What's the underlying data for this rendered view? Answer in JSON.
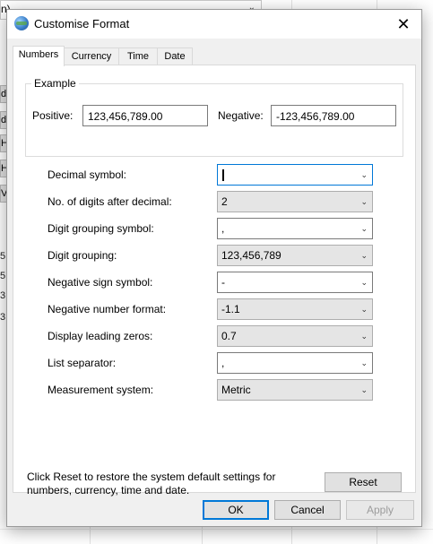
{
  "background": {
    "top_field_text": "n)",
    "left_buttons": [
      "dd",
      "dd",
      "H",
      "H",
      "V"
    ],
    "left_numbers": [
      "5,",
      "5",
      "3",
      "3"
    ]
  },
  "dialog": {
    "title": "Customise Format",
    "close_symbol": "✕"
  },
  "tabs": [
    {
      "label": "Numbers",
      "active": true
    },
    {
      "label": "Currency",
      "active": false
    },
    {
      "label": "Time",
      "active": false
    },
    {
      "label": "Date",
      "active": false
    }
  ],
  "example": {
    "group_label": "Example",
    "positive_label": "Positive:",
    "positive_value": "123,456,789.00",
    "negative_label": "Negative:",
    "negative_value": "-123,456,789.00"
  },
  "settings": [
    {
      "label": "Decimal symbol:",
      "value": "",
      "style": "white",
      "focused": true
    },
    {
      "label": "No. of digits after decimal:",
      "value": "2",
      "style": "grey"
    },
    {
      "label": "Digit grouping symbol:",
      "value": ",",
      "style": "white"
    },
    {
      "label": "Digit grouping:",
      "value": "123,456,789",
      "style": "grey"
    },
    {
      "label": "Negative sign symbol:",
      "value": "-",
      "style": "white"
    },
    {
      "label": "Negative number format:",
      "value": "-1.1",
      "style": "grey"
    },
    {
      "label": "Display leading zeros:",
      "value": "0.7",
      "style": "grey"
    },
    {
      "label": "List separator:",
      "value": ",",
      "style": "white"
    },
    {
      "label": "Measurement system:",
      "value": "Metric",
      "style": "grey"
    }
  ],
  "reset_note_line1": "Click Reset to restore the system default settings for",
  "reset_note_line2": "numbers, currency, time and date.",
  "buttons": {
    "reset": "Reset",
    "ok": "OK",
    "cancel": "Cancel",
    "apply": "Apply"
  },
  "colors": {
    "focus_border": "#0078d7",
    "dialog_bg": "#f0f0f0"
  }
}
